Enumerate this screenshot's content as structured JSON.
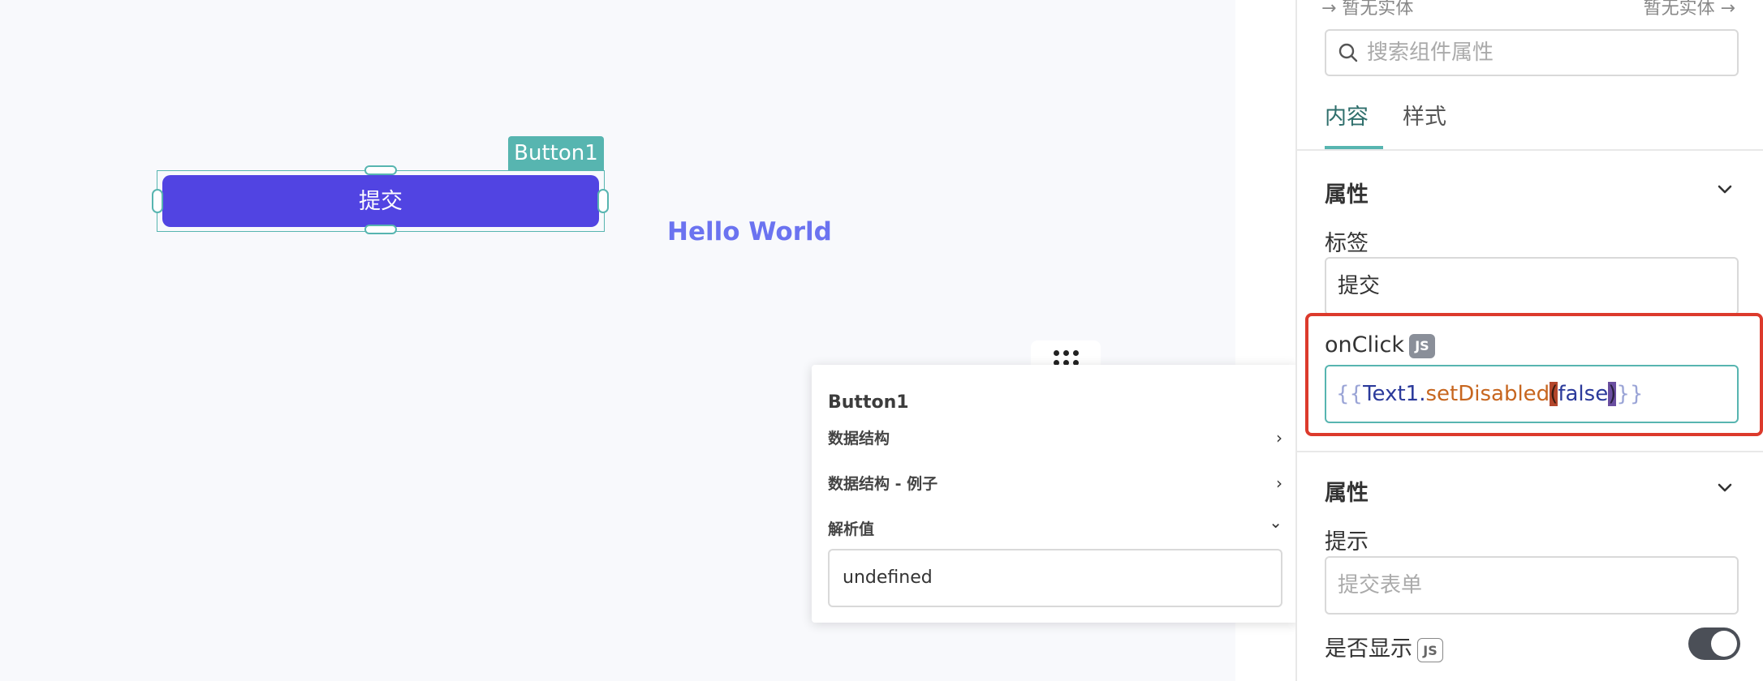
{
  "canvas": {
    "selected_component_tag": "Button1",
    "submit_button_label": "提交",
    "hello_text": "Hello World"
  },
  "popover": {
    "title": "Button1",
    "rows": [
      {
        "label": "数据结构",
        "chevron": "›"
      },
      {
        "label": "数据结构 - 例子",
        "chevron": "›"
      },
      {
        "label": "解析值",
        "chevron": "⌄"
      }
    ],
    "parsed_value": "undefined"
  },
  "panel": {
    "entity_left": "→ 暂无实体",
    "entity_right": "暂无实体 →",
    "search_placeholder": "搜索组件属性",
    "tabs": [
      {
        "label": "内容",
        "active": true
      },
      {
        "label": "样式",
        "active": false
      }
    ],
    "section1": {
      "title": "属性",
      "label_field": {
        "label": "标签",
        "value": "提交"
      },
      "onclick_field": {
        "label": "onClick",
        "badge": "JS",
        "code": {
          "open_brace": "{{",
          "object": "Text1",
          "dot": ".",
          "method": "setDisabled",
          "paren_open": "(",
          "arg": "false",
          "paren_close": ")",
          "close_brace": "}}"
        }
      }
    },
    "section2": {
      "title": "属性",
      "hint_field": {
        "label": "提示",
        "placeholder": "提交表单"
      },
      "visible_field": {
        "label": "是否显示",
        "badge": "JS",
        "enabled": true
      }
    }
  },
  "colors": {
    "accent": "#57b5b0",
    "button": "#5144e2",
    "highlight_border": "#dc3a2c",
    "hello": "#6b73f0"
  }
}
